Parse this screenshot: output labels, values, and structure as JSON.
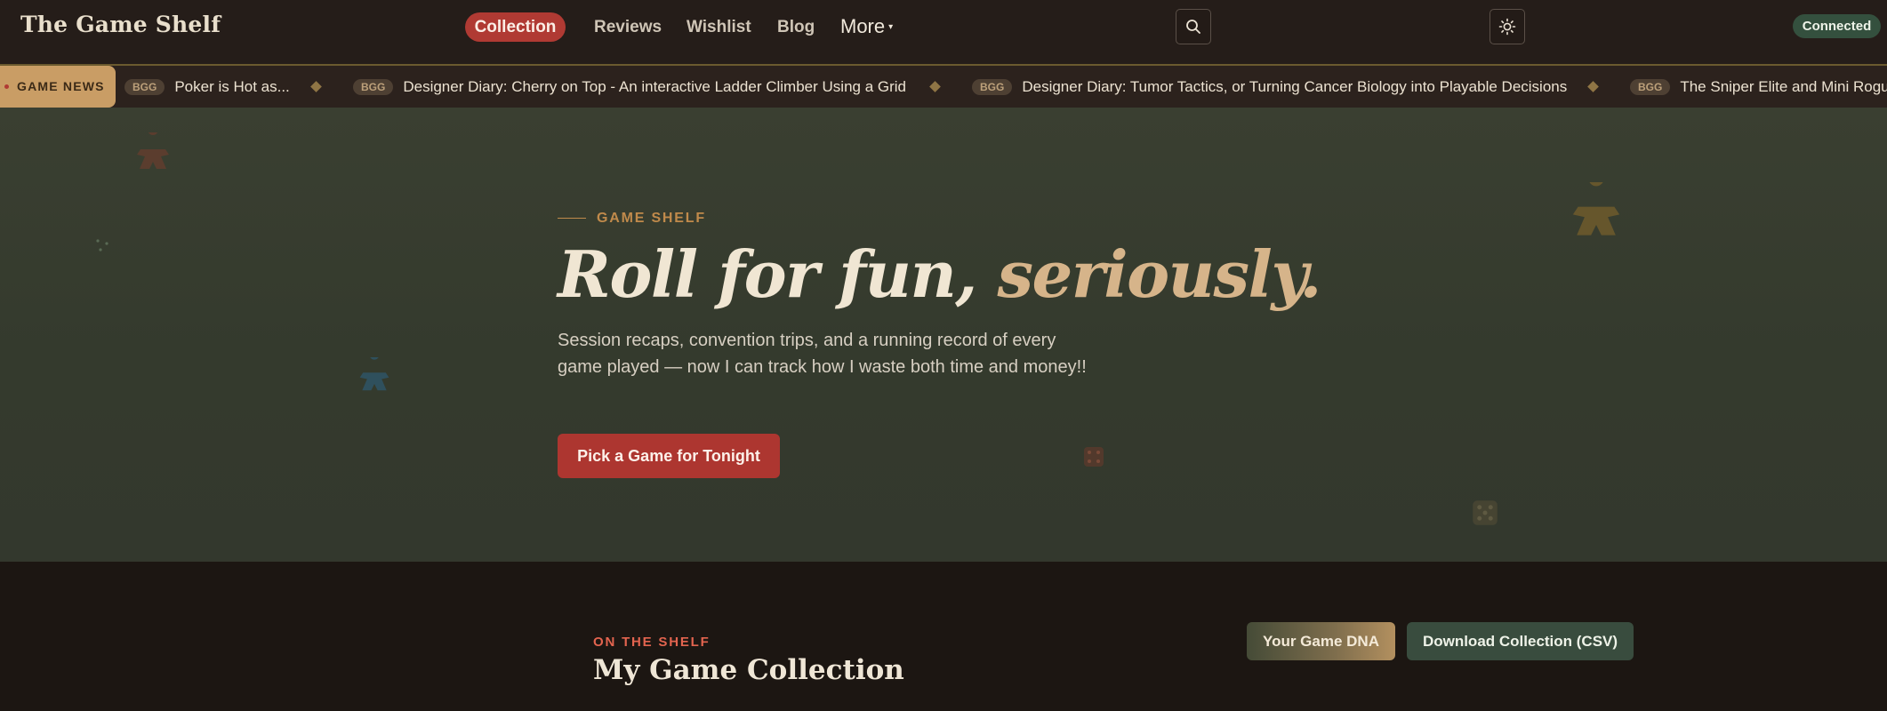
{
  "brand": {
    "name": "The Game Shelf"
  },
  "nav": {
    "items": [
      {
        "label": "Collection",
        "active": true
      },
      {
        "label": "Reviews"
      },
      {
        "label": "Wishlist"
      },
      {
        "label": "Blog"
      }
    ],
    "more_label": "More",
    "more_caret": "▾",
    "search_icon": "search-icon",
    "theme_icon": "sun-icon",
    "status_label": "Connected"
  },
  "ticker": {
    "label": "GAME NEWS",
    "items": [
      {
        "badge": "BGG",
        "text": "Poker is Hot as..."
      },
      {
        "badge": "BGG",
        "text": "Designer Diary: Cherry on Top - An interactive Ladder Climber Using a Grid"
      },
      {
        "badge": "BGG",
        "text": "Designer Diary: Tumor Tactics, or Turning Cancer Biology into Playable Decisions"
      },
      {
        "badge": "BGG",
        "text": "The Sniper Elite and Mini Rogue"
      }
    ]
  },
  "hero": {
    "eyebrow": "GAME SHELF",
    "headline_main": "Roll for fun, ",
    "headline_accent": "seriously.",
    "lede": "Session recaps, convention trips, and a running record of every game played — now I can track how I waste both time and money!!",
    "cta_label": "Pick a Game for Tonight",
    "decorations": [
      "meeple-icon",
      "dice-icon"
    ]
  },
  "shelf": {
    "eyebrow": "ON THE SHELF",
    "title": "My Game Collection",
    "dna_button": "Your Game DNA",
    "csv_button": "Download Collection (CSV)"
  },
  "colors": {
    "accent_red": "#b03a33",
    "accent_gold": "#c99d65",
    "status_green": "#34503e",
    "hero_bg": "#363c2f",
    "page_bg": "#1c1612"
  }
}
